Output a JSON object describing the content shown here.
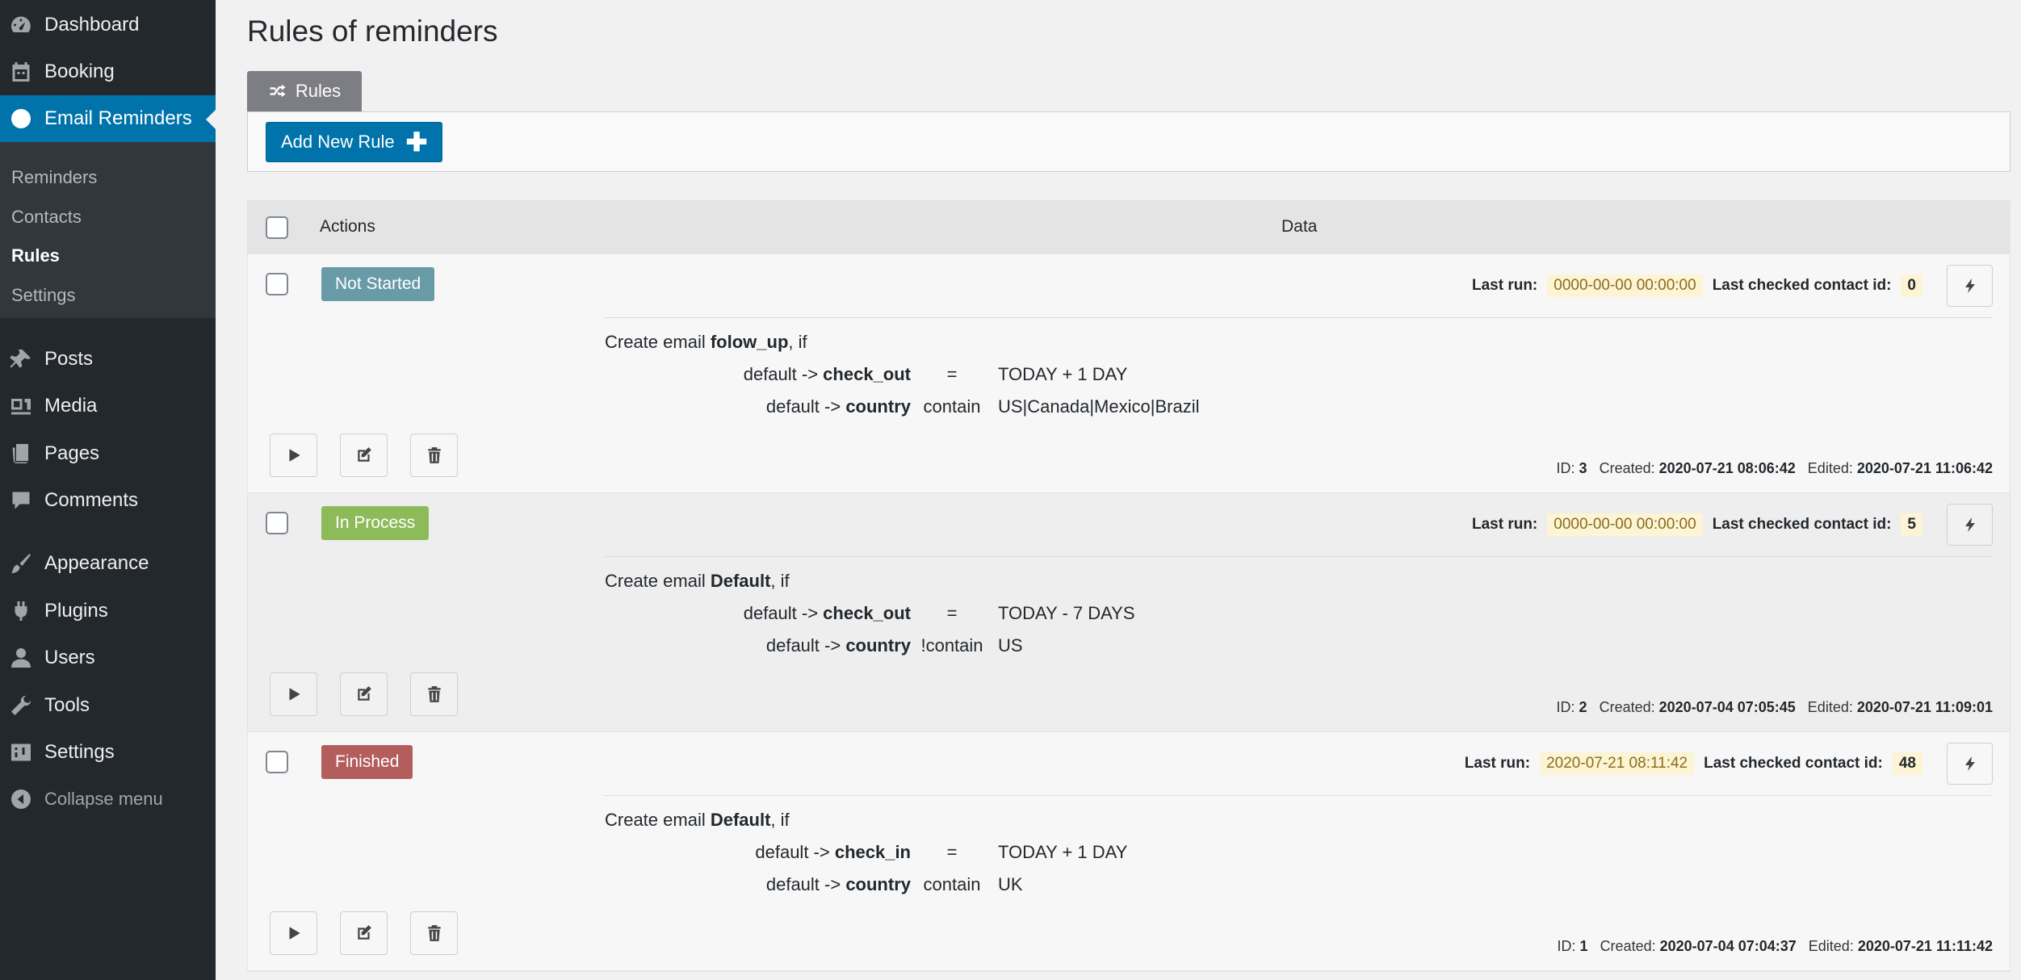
{
  "sidebar": {
    "items": [
      {
        "label": "Dashboard",
        "icon": "dashboard-icon"
      },
      {
        "label": "Booking",
        "icon": "calendar-icon"
      },
      {
        "label": "Email Reminders",
        "icon": "reminders-icon"
      },
      {
        "label": "Posts",
        "icon": "pin-icon"
      },
      {
        "label": "Media",
        "icon": "media-icon"
      },
      {
        "label": "Pages",
        "icon": "pages-icon"
      },
      {
        "label": "Comments",
        "icon": "comment-icon"
      },
      {
        "label": "Appearance",
        "icon": "paintbrush-icon"
      },
      {
        "label": "Plugins",
        "icon": "plugin-icon"
      },
      {
        "label": "Users",
        "icon": "user-icon"
      },
      {
        "label": "Tools",
        "icon": "wrench-icon"
      },
      {
        "label": "Settings",
        "icon": "settings-icon"
      },
      {
        "label": "Collapse menu",
        "icon": "collapse-icon"
      }
    ],
    "submenu": [
      "Reminders",
      "Contacts",
      "Rules",
      "Settings"
    ],
    "active_submenu": "Rules"
  },
  "page": {
    "title": "Rules of reminders",
    "tab_label": "Rules",
    "add_button_label": "Add New Rule",
    "add_button_symbol": "✚"
  },
  "table": {
    "columns": {
      "actions": "Actions",
      "data": "Data"
    },
    "labels": {
      "last_run": "Last run:",
      "last_checked": "Last checked contact id:",
      "id": "ID:",
      "created": "Created:",
      "edited": "Edited:",
      "create_email": "Create email",
      "if": ", if"
    },
    "rows": [
      {
        "status": "Not Started",
        "status_color": "#689aa7",
        "last_run": "0000-00-00 00:00:00",
        "last_checked_id": "0",
        "email": "folow_up",
        "conditions": [
          {
            "prefix": "default ->",
            "field": "check_out",
            "op": "=",
            "value": "TODAY + 1 DAY"
          },
          {
            "prefix": "default ->",
            "field": "country",
            "op": "contain",
            "value": "US|Canada|Mexico|Brazil"
          }
        ],
        "id": "3",
        "created": "2020-07-21 08:06:42",
        "edited": "2020-07-21 11:06:42"
      },
      {
        "status": "In Process",
        "status_color": "#8dbb5a",
        "last_run": "0000-00-00 00:00:00",
        "last_checked_id": "5",
        "email": "Default",
        "conditions": [
          {
            "prefix": "default ->",
            "field": "check_out",
            "op": "=",
            "value": "TODAY - 7 DAYS"
          },
          {
            "prefix": "default ->",
            "field": "country",
            "op": "!contain",
            "value": "US"
          }
        ],
        "id": "2",
        "created": "2020-07-04 07:05:45",
        "edited": "2020-07-21 11:09:01"
      },
      {
        "status": "Finished",
        "status_color": "#b35d5d",
        "last_run": "2020-07-21 08:11:42",
        "last_checked_id": "48",
        "email": "Default",
        "conditions": [
          {
            "prefix": "default ->",
            "field": "check_in",
            "op": "=",
            "value": "TODAY + 1 DAY"
          },
          {
            "prefix": "default ->",
            "field": "country",
            "op": "contain",
            "value": "UK"
          }
        ],
        "id": "1",
        "created": "2020-07-04 07:04:37",
        "edited": "2020-07-21 11:11:42"
      }
    ]
  }
}
